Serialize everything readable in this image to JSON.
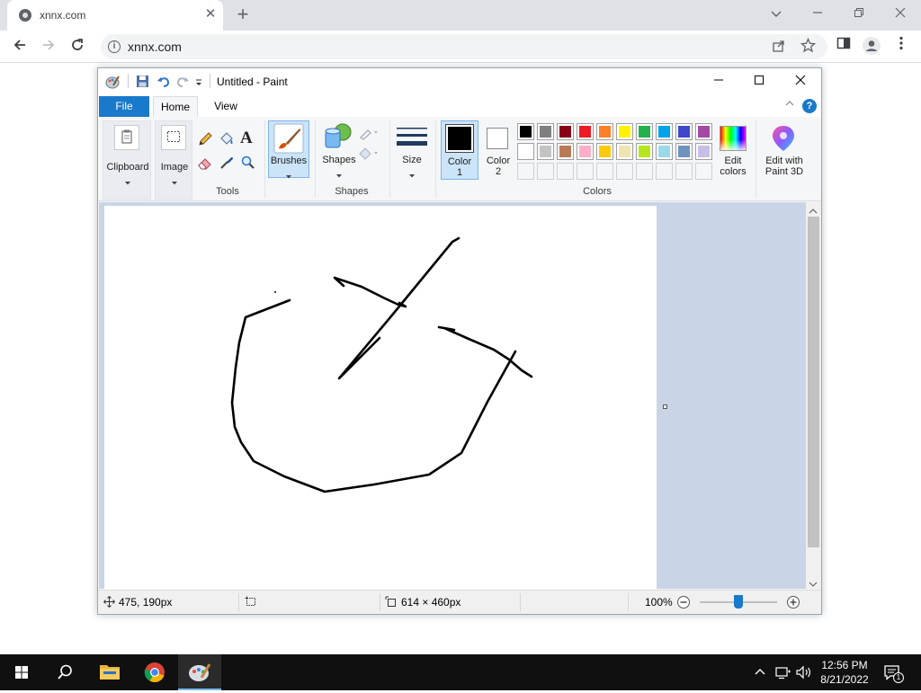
{
  "browser": {
    "tab_title": "xnnx.com",
    "tab_close": "✕",
    "new_tab": "+",
    "url": "xnnx.com",
    "info_glyph": "i"
  },
  "paint": {
    "window_title": "Untitled - Paint",
    "tabs": {
      "file": "File",
      "home": "Home",
      "view": "View"
    },
    "help": "?",
    "ribbon": {
      "clipboard": "Clipboard",
      "image": "Image",
      "tools_group": "Tools",
      "brushes": "Brushes",
      "shapes": "Shapes",
      "shapes_group": "Shapes",
      "size": "Size",
      "color1": [
        "Color",
        "1"
      ],
      "color2": [
        "Color",
        "2"
      ],
      "colors_group": "Colors",
      "edit_colors": [
        "Edit",
        "colors"
      ],
      "edit_3d": [
        "Edit with",
        "Paint 3D"
      ],
      "text_tool": "A",
      "palette_row1": [
        "#000000",
        "#7f7f7f",
        "#880015",
        "#ed1c24",
        "#ff7f27",
        "#fff200",
        "#22b14c",
        "#00a2e8",
        "#3f48cc",
        "#a349a4"
      ],
      "palette_row2": [
        "#ffffff",
        "#c3c3c3",
        "#b97a57",
        "#ffaec9",
        "#ffc90e",
        "#efe4b0",
        "#b5e61d",
        "#99d9ea",
        "#7092be",
        "#c8bfe7"
      ],
      "color1_value": "#000000",
      "color2_value": "#ffffff"
    },
    "status": {
      "cursor_pos": "475, 190px",
      "canvas_size": "614 × 460px",
      "zoom": "100%"
    }
  },
  "taskbar": {
    "time": "12:56 PM",
    "date": "8/21/2022",
    "notification_count": "1"
  }
}
